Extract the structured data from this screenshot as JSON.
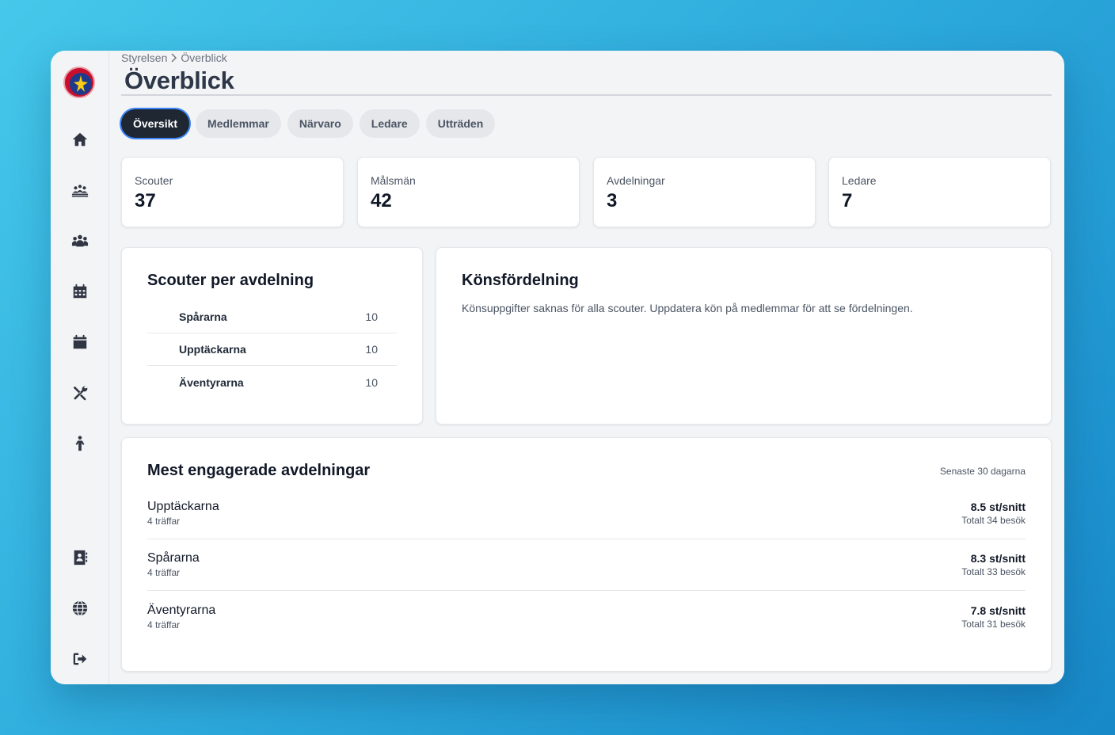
{
  "breadcrumb": {
    "parent": "Styrelsen",
    "current": "Överblick"
  },
  "page_title": "Överblick",
  "tabs": [
    {
      "label": "Översikt",
      "active": true
    },
    {
      "label": "Medlemmar",
      "active": false
    },
    {
      "label": "Närvaro",
      "active": false
    },
    {
      "label": "Ledare",
      "active": false
    },
    {
      "label": "Utträden",
      "active": false
    }
  ],
  "stats": [
    {
      "label": "Scouter",
      "value": "37"
    },
    {
      "label": "Målsmän",
      "value": "42"
    },
    {
      "label": "Avdelningar",
      "value": "3"
    },
    {
      "label": "Ledare",
      "value": "7"
    }
  ],
  "scouts_per_unit": {
    "title": "Scouter per avdelning",
    "rows": [
      {
        "name": "Spårarna",
        "count": "10"
      },
      {
        "name": "Upptäckarna",
        "count": "10"
      },
      {
        "name": "Äventyrarna",
        "count": "10"
      }
    ]
  },
  "gender": {
    "title": "Könsfördelning",
    "message": "Könsuppgifter saknas för alla scouter. Uppdatera kön på medlemmar för att se fördelningen."
  },
  "engagement": {
    "title": "Mest engagerade avdelningar",
    "period": "Senaste 30 dagarna",
    "rows": [
      {
        "name": "Upptäckarna",
        "meetings": "4 träffar",
        "average": "8.5 st/snitt",
        "total": "Totalt 34 besök"
      },
      {
        "name": "Spårarna",
        "meetings": "4 träffar",
        "average": "8.3 st/snitt",
        "total": "Totalt 33 besök"
      },
      {
        "name": "Äventyrarna",
        "meetings": "4 träffar",
        "average": "7.8 st/snitt",
        "total": "Totalt 31 besök"
      }
    ]
  },
  "sidebar_icons": [
    "home-icon",
    "campfire-group-icon",
    "users-icon",
    "calendar-grid-icon",
    "calendar-icon",
    "tools-icon",
    "child-icon",
    "contact-book-icon",
    "globe-icon",
    "logout-icon"
  ],
  "colors": {
    "active_tab": "#1f2733",
    "focus_ring": "#3b82f6",
    "logo_red": "#c8102e"
  }
}
